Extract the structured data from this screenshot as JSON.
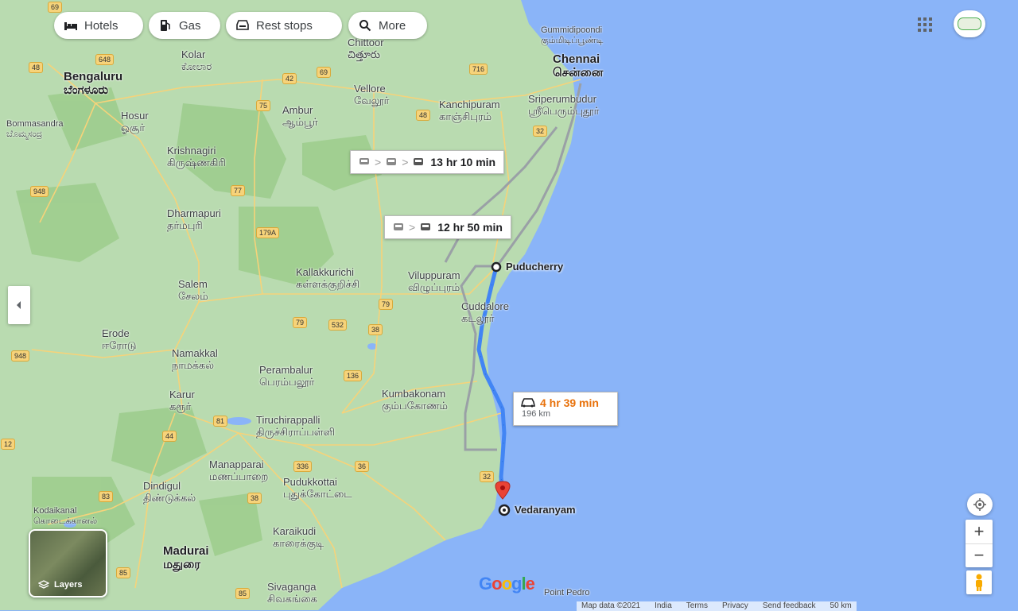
{
  "filters": [
    {
      "label": "Hotels",
      "icon": "bed-icon"
    },
    {
      "label": "Gas",
      "icon": "fuel-pump-icon"
    },
    {
      "label": "Rest stops",
      "icon": "rest-stop-icon"
    },
    {
      "label": "More",
      "icon": "search-icon"
    }
  ],
  "route_labels": {
    "transit_long": "13 hr 10 min",
    "transit_short": "12 hr 50 min",
    "drive_time": "4 hr 39 min",
    "drive_distance": "196 km"
  },
  "places": {
    "origin": "Puducherry",
    "destination": "Vedaranyam"
  },
  "cities": [
    [
      "Bengaluru",
      "ಬೆಂಗಳೂರು"
    ],
    [
      "Kolar",
      "ಕೋಲಾರ"
    ],
    [
      "Chennai",
      "சென்னை"
    ],
    [
      "Vellore",
      "வேலூர்"
    ],
    [
      "Kanchipuram",
      "காஞ்சிபுரம்"
    ],
    [
      "Sriperumbudur",
      "ஸ்ரீபெரும்புதூர்"
    ],
    [
      "Hosur",
      "ஓசூர்"
    ],
    [
      "Krishnagiri",
      "கிருஷ்ணகிரி"
    ],
    [
      "Ambur",
      "ஆம்பூர்"
    ],
    [
      "Chittoor",
      "చిత్తూరు"
    ],
    [
      "Dharmapuri",
      "தர்மபுரி"
    ],
    [
      "Salem",
      "சேலம்"
    ],
    [
      "Kallakkurichi",
      "கள்ளக்குறிச்சி"
    ],
    [
      "Viluppuram",
      "விழுப்புரம்"
    ],
    [
      "Cuddalore",
      "கடலூர்"
    ],
    [
      "Erode",
      "ஈரோடு"
    ],
    [
      "Namakkal",
      "நாமக்கல்"
    ],
    [
      "Perambalur",
      "பெரம்பலூர்"
    ],
    [
      "Kumbakonam",
      "கும்பகோணம்"
    ],
    [
      "Karur",
      "கரூர்"
    ],
    [
      "Tiruchirappalli",
      "திருச்சிராப்பள்ளி"
    ],
    [
      "Manapparai",
      "மணப்பாறை"
    ],
    [
      "Dindigul",
      "திண்டுக்கல்"
    ],
    [
      "Pudukkottai",
      "புதுக்கோட்டை"
    ],
    [
      "Karaikudi",
      "காரைக்குடி"
    ],
    [
      "Madurai",
      "மதுரை"
    ],
    [
      "Sivaganga",
      "சிவகங்கை"
    ],
    [
      "Kodaikanal",
      "கொடைக்கானல்"
    ],
    [
      "Gummidipoondi",
      "கும்மிடிப்பூண்டி"
    ],
    [
      "Bommasandra",
      "ಬೊಮ್ಮಸಂದ್ರ"
    ],
    [
      "Point Pedro",
      ""
    ]
  ],
  "road_numbers": [
    "69",
    "648",
    "48",
    "42",
    "69",
    "716",
    "75",
    "48",
    "32",
    "948",
    "77",
    "179A",
    "79",
    "532",
    "38",
    "79",
    "948",
    "136",
    "81",
    "44",
    "336",
    "36",
    "32",
    "83",
    "38",
    "85",
    "85",
    "12"
  ],
  "layers_label": "Layers",
  "footer": [
    "Map data ©2021",
    "India",
    "Terms",
    "Privacy",
    "Send feedback",
    "50 km"
  ],
  "google_logo": "Google",
  "colors": {
    "water": "#8ab4f8",
    "land": "#b8dcaa",
    "route": "#4285f4",
    "alt_route": "#9aa0a6",
    "drive_time": "#e8710a",
    "pin": "#ea4335"
  }
}
